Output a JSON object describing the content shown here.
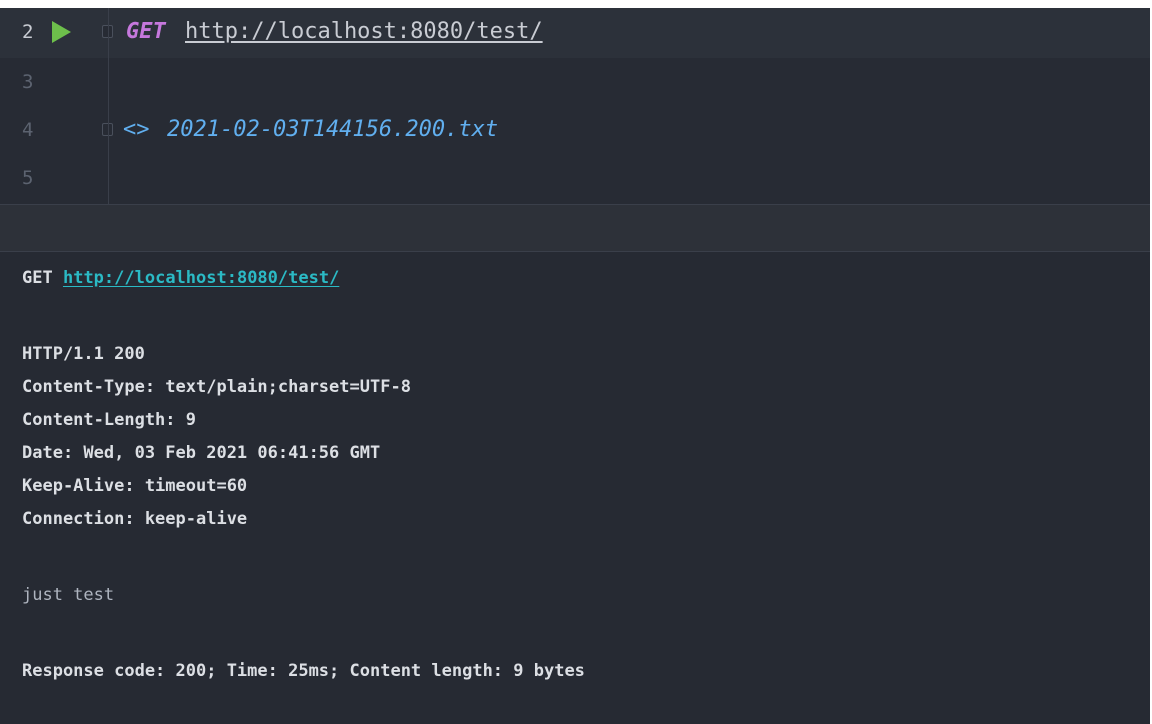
{
  "editor": {
    "lines": [
      {
        "number": "2"
      },
      {
        "number": "3"
      },
      {
        "number": "4"
      },
      {
        "number": "5"
      }
    ],
    "request": {
      "method": "GET",
      "url": "http://localhost:8080/test/"
    },
    "response_ref": {
      "symbol": "<>",
      "file": "2021-02-03T144156.200.txt"
    }
  },
  "console": {
    "request": {
      "method": "GET",
      "url": "http://localhost:8080/test/"
    },
    "status_line": "HTTP/1.1 200",
    "headers": [
      "Content-Type: text/plain;charset=UTF-8",
      "Content-Length: 9",
      "Date: Wed, 03 Feb 2021 06:41:56 GMT",
      "Keep-Alive: timeout=60",
      "Connection: keep-alive"
    ],
    "body": "just test",
    "summary": "Response code: 200; Time: 25ms; Content length: 9 bytes"
  },
  "colors": {
    "background": "#262a33",
    "method_keyword": "#c678dd",
    "run_icon": "#6dbf4b",
    "response_file": "#61afef",
    "console_link": "#2bbac5"
  },
  "icons": {
    "run": "run-icon",
    "fold": "fold-marker-icon",
    "response": "response-arrow-icon"
  }
}
